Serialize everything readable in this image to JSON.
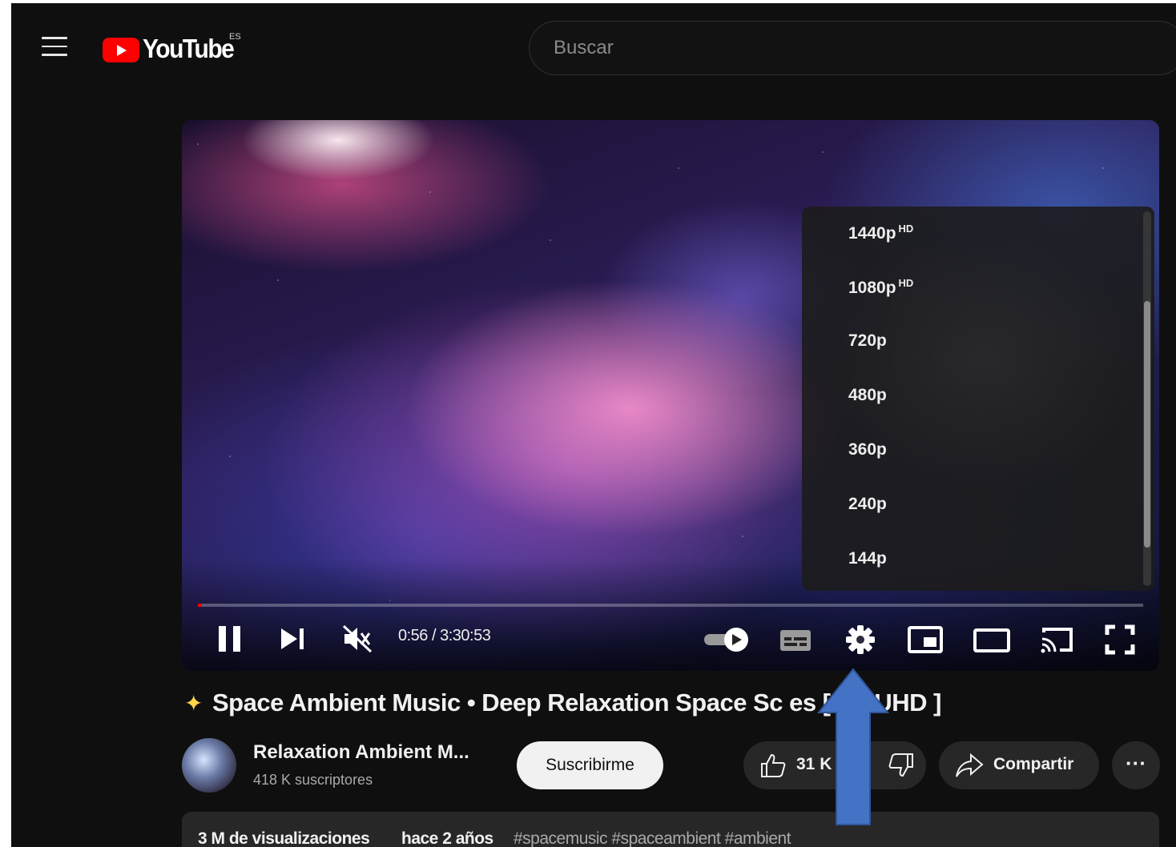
{
  "header": {
    "logo_text": "YouTube",
    "country_code": "ES",
    "search_placeholder": "Buscar"
  },
  "player": {
    "quality_options": [
      {
        "label": "1440p",
        "badge": "HD"
      },
      {
        "label": "1080p",
        "badge": "HD"
      },
      {
        "label": "720p",
        "badge": ""
      },
      {
        "label": "480p",
        "badge": ""
      },
      {
        "label": "360p",
        "badge": ""
      },
      {
        "label": "240p",
        "badge": ""
      },
      {
        "label": "144p",
        "badge": ""
      }
    ],
    "time": "0:56 / 3:30:53",
    "progress_fraction": 0.0045,
    "controls": [
      "pause-icon",
      "next-icon",
      "mute-icon",
      "autoplay-toggle-icon",
      "subtitles-icon",
      "gear-icon",
      "miniplayer-icon",
      "theater-icon",
      "cast-icon",
      "fullscreen-icon"
    ]
  },
  "video": {
    "title": "Space Ambient Music • Deep Relaxation Space Sc   es [ 4K UHD ]",
    "channel_name": "Relaxation Ambient M...",
    "subscribers": "418 K suscriptores",
    "subscribe_label": "Suscribirme",
    "likes": "31 K",
    "share_label": "Compartir",
    "more_label": "···",
    "views": "3 M de visualizaciones",
    "date": "hace 2 años",
    "hashtags": "#spacemusic #spaceambient #ambient"
  },
  "colors": {
    "background": "#0f0f0f",
    "accent": "#ff0000",
    "annotation_arrow": "#4472c4"
  }
}
